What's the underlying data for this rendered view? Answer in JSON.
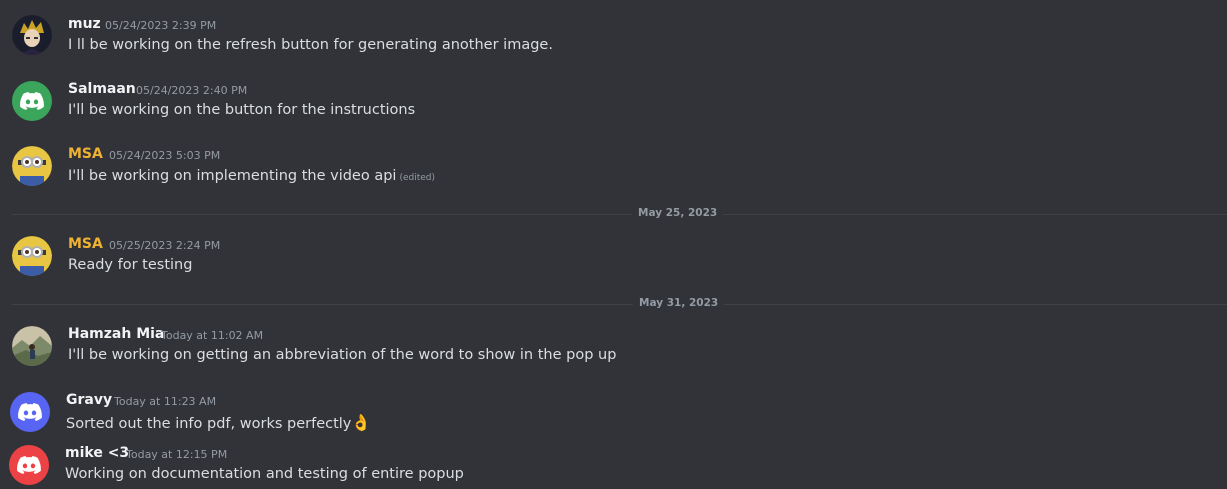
{
  "messages": [
    {
      "author": "muz",
      "timestamp": "05/24/2023 2:39 PM",
      "text": "I ll be working on the refresh button for generating another image.",
      "author_color": "#f2f3f5"
    },
    {
      "author": "Salmaan",
      "timestamp": "05/24/2023 2:40 PM",
      "text": "I'll be working on the button for the instructions",
      "author_color": "#f2f3f5"
    },
    {
      "author": "MSA",
      "timestamp": "05/24/2023 5:03 PM",
      "text": "I'll  be working on implementing the video api",
      "edited": "(edited)",
      "author_color": "#f0b232"
    },
    {
      "author": "MSA",
      "timestamp": "05/25/2023 2:24 PM",
      "text": "Ready for testing",
      "author_color": "#f0b232"
    },
    {
      "author": "Hamzah Mia",
      "timestamp": "Today at 11:02 AM",
      "text": "I'll be working on getting an abbreviation of the word to show in the pop up",
      "author_color": "#f2f3f5"
    },
    {
      "author": "Gravy",
      "timestamp": "Today at 11:23 AM",
      "text": "Sorted out the info pdf, works perfectly",
      "emoji": "👌",
      "author_color": "#f2f3f5"
    },
    {
      "author": "mike <3",
      "timestamp": "Today at 12:15 PM",
      "text": "Working on documentation and testing of entire popup",
      "author_color": "#f2f3f5"
    }
  ],
  "dividers": [
    "May 25, 2023",
    "May 31, 2023"
  ],
  "colors": {
    "background": "#313338",
    "salmaan_avatar": "#3ba55c",
    "gravy_avatar": "#5865f2",
    "mike_avatar": "#ed4245"
  },
  "icons": {
    "discord_default": "discord-logo-icon"
  }
}
